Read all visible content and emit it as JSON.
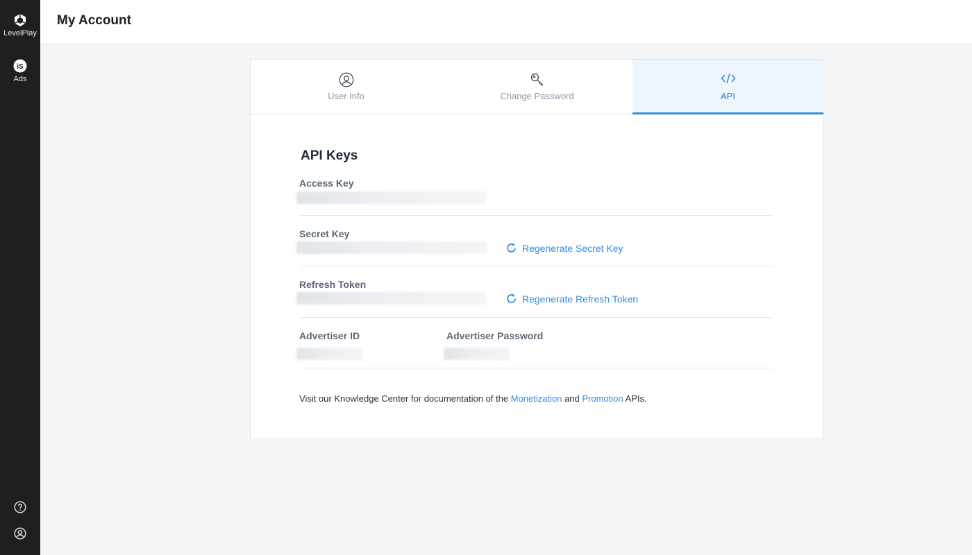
{
  "sidebar": {
    "items": [
      {
        "label": "LevelPlay",
        "icon": "unity-logo-icon"
      },
      {
        "label": "Ads",
        "icon": "is-logo-icon"
      }
    ],
    "bottom_icons": [
      "help-icon",
      "user-account-icon"
    ]
  },
  "header": {
    "title": "My Account"
  },
  "tabs": [
    {
      "label": "User Info",
      "icon": "user-circle-icon",
      "active": false
    },
    {
      "label": "Change Password",
      "icon": "key-icon",
      "active": false
    },
    {
      "label": "API",
      "icon": "code-icon",
      "active": true
    }
  ],
  "api": {
    "title": "API Keys",
    "access_key_label": "Access Key",
    "secret_key_label": "Secret Key",
    "regen_secret_label": "Regenerate Secret Key",
    "refresh_token_label": "Refresh Token",
    "regen_refresh_label": "Regenerate Refresh Token",
    "advertiser_id_label": "Advertiser ID",
    "advertiser_password_label": "Advertiser Password"
  },
  "footnote": {
    "prefix": "Visit our Knowledge Center for documentation of the ",
    "link1": "Monetization",
    "middle": " and ",
    "link2": "Promotion",
    "suffix": " APIs."
  },
  "colors": {
    "accent": "#2f8de4",
    "sidebar_bg": "#1f1f1f",
    "active_tab_bg": "#eef6fd"
  }
}
